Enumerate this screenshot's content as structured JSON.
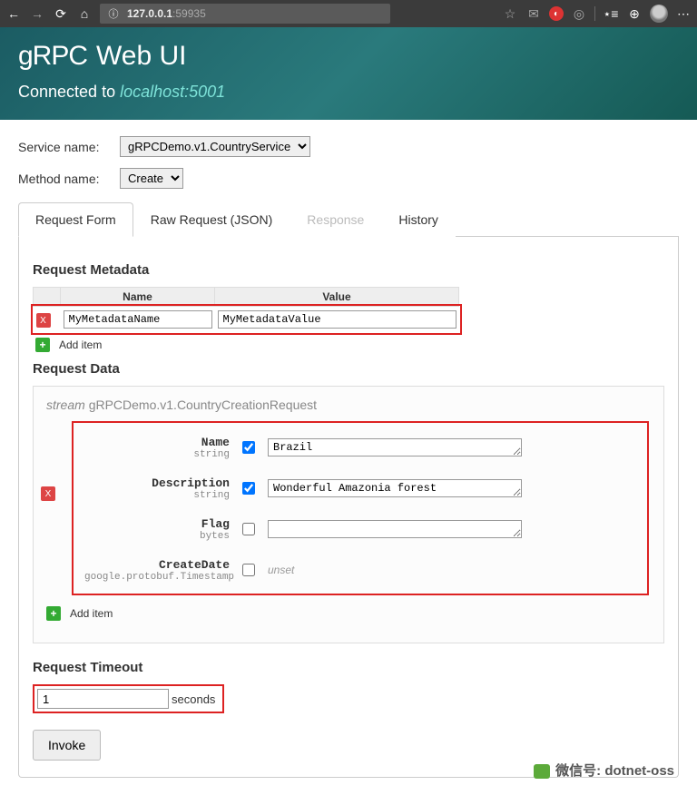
{
  "chrome": {
    "address_ip": "127.0.0.1",
    "address_port": ":59935"
  },
  "header": {
    "logo": "gRPC",
    "title": "Web UI",
    "connected_label": "Connected to",
    "host": "localhost:5001"
  },
  "form": {
    "service_label": "Service name:",
    "service_value": "gRPCDemo.v1.CountryService",
    "method_label": "Method name:",
    "method_value": "Create"
  },
  "tabs": [
    {
      "label": "Request Form",
      "active": true
    },
    {
      "label": "Raw Request (JSON)"
    },
    {
      "label": "Response",
      "disabled": true
    },
    {
      "label": "History"
    }
  ],
  "metadata": {
    "title": "Request Metadata",
    "col_name": "Name",
    "col_value": "Value",
    "rows": [
      {
        "name": "MyMetadataName",
        "value": "MyMetadataValue"
      }
    ],
    "add_item": "Add item"
  },
  "data": {
    "title": "Request Data",
    "stream_prefix": "stream",
    "stream_type": "gRPCDemo.v1.CountryCreationRequest",
    "fields": [
      {
        "name": "Name",
        "type": "string",
        "checked": true,
        "value": "Brazil"
      },
      {
        "name": "Description",
        "type": "string",
        "checked": true,
        "value": "Wonderful Amazonia forest"
      },
      {
        "name": "Flag",
        "type": "bytes",
        "checked": false,
        "value": ""
      },
      {
        "name": "CreateDate",
        "type": "google.protobuf.Timestamp",
        "checked": false,
        "unset": "unset"
      }
    ],
    "add_item": "Add item"
  },
  "timeout": {
    "title": "Request Timeout",
    "value": "1",
    "unit": "seconds"
  },
  "invoke": "Invoke",
  "watermark": "微信号: dotnet-oss"
}
